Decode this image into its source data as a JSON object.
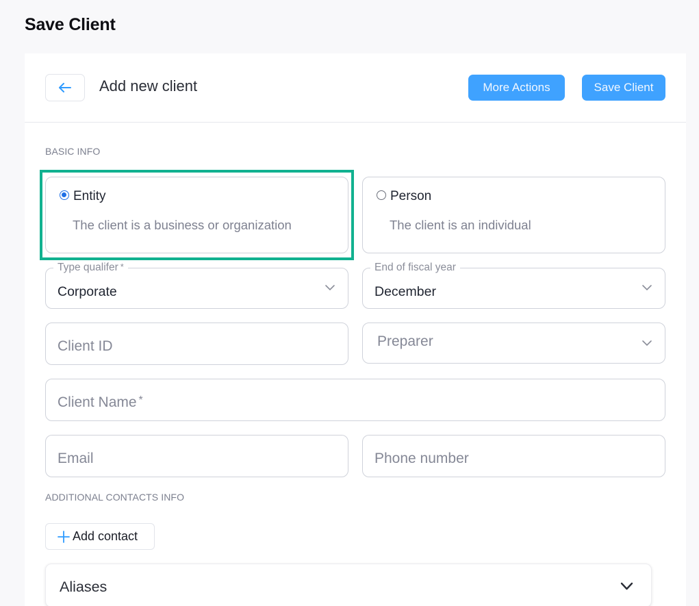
{
  "page": {
    "title": "Save Client"
  },
  "header": {
    "back_icon": "arrow-left-icon",
    "title": "Add new client",
    "more_actions_label": "More Actions",
    "save_label": "Save Client"
  },
  "basic_info": {
    "section_label": "BASIC INFO",
    "client_type": {
      "selected": "Entity",
      "options": [
        {
          "title": "Entity",
          "description": "The client is a business or organization",
          "checked": true
        },
        {
          "title": "Person",
          "description": "The client is an individual",
          "checked": false
        }
      ]
    },
    "type_qualifier": {
      "label": "Type qualifer",
      "required_mark": "*",
      "value": "Corporate"
    },
    "fiscal_year_end": {
      "label": "End of fiscal year",
      "value": "December"
    },
    "client_id": {
      "placeholder": "Client ID"
    },
    "preparer": {
      "placeholder": "Preparer"
    },
    "client_name": {
      "placeholder": "Client Name",
      "required_mark": "*"
    },
    "email": {
      "placeholder": "Email"
    },
    "phone": {
      "placeholder": "Phone number"
    }
  },
  "additional_contacts": {
    "section_label": "ADDITIONAL CONTACTS INFO",
    "add_contact_label": "Add contact",
    "add_icon": "plus-icon"
  },
  "aliases": {
    "label": "Aliases"
  },
  "colors": {
    "accent": "#2f9bff",
    "highlight": "#11b190",
    "radio_checked": "#1f6fe6"
  }
}
